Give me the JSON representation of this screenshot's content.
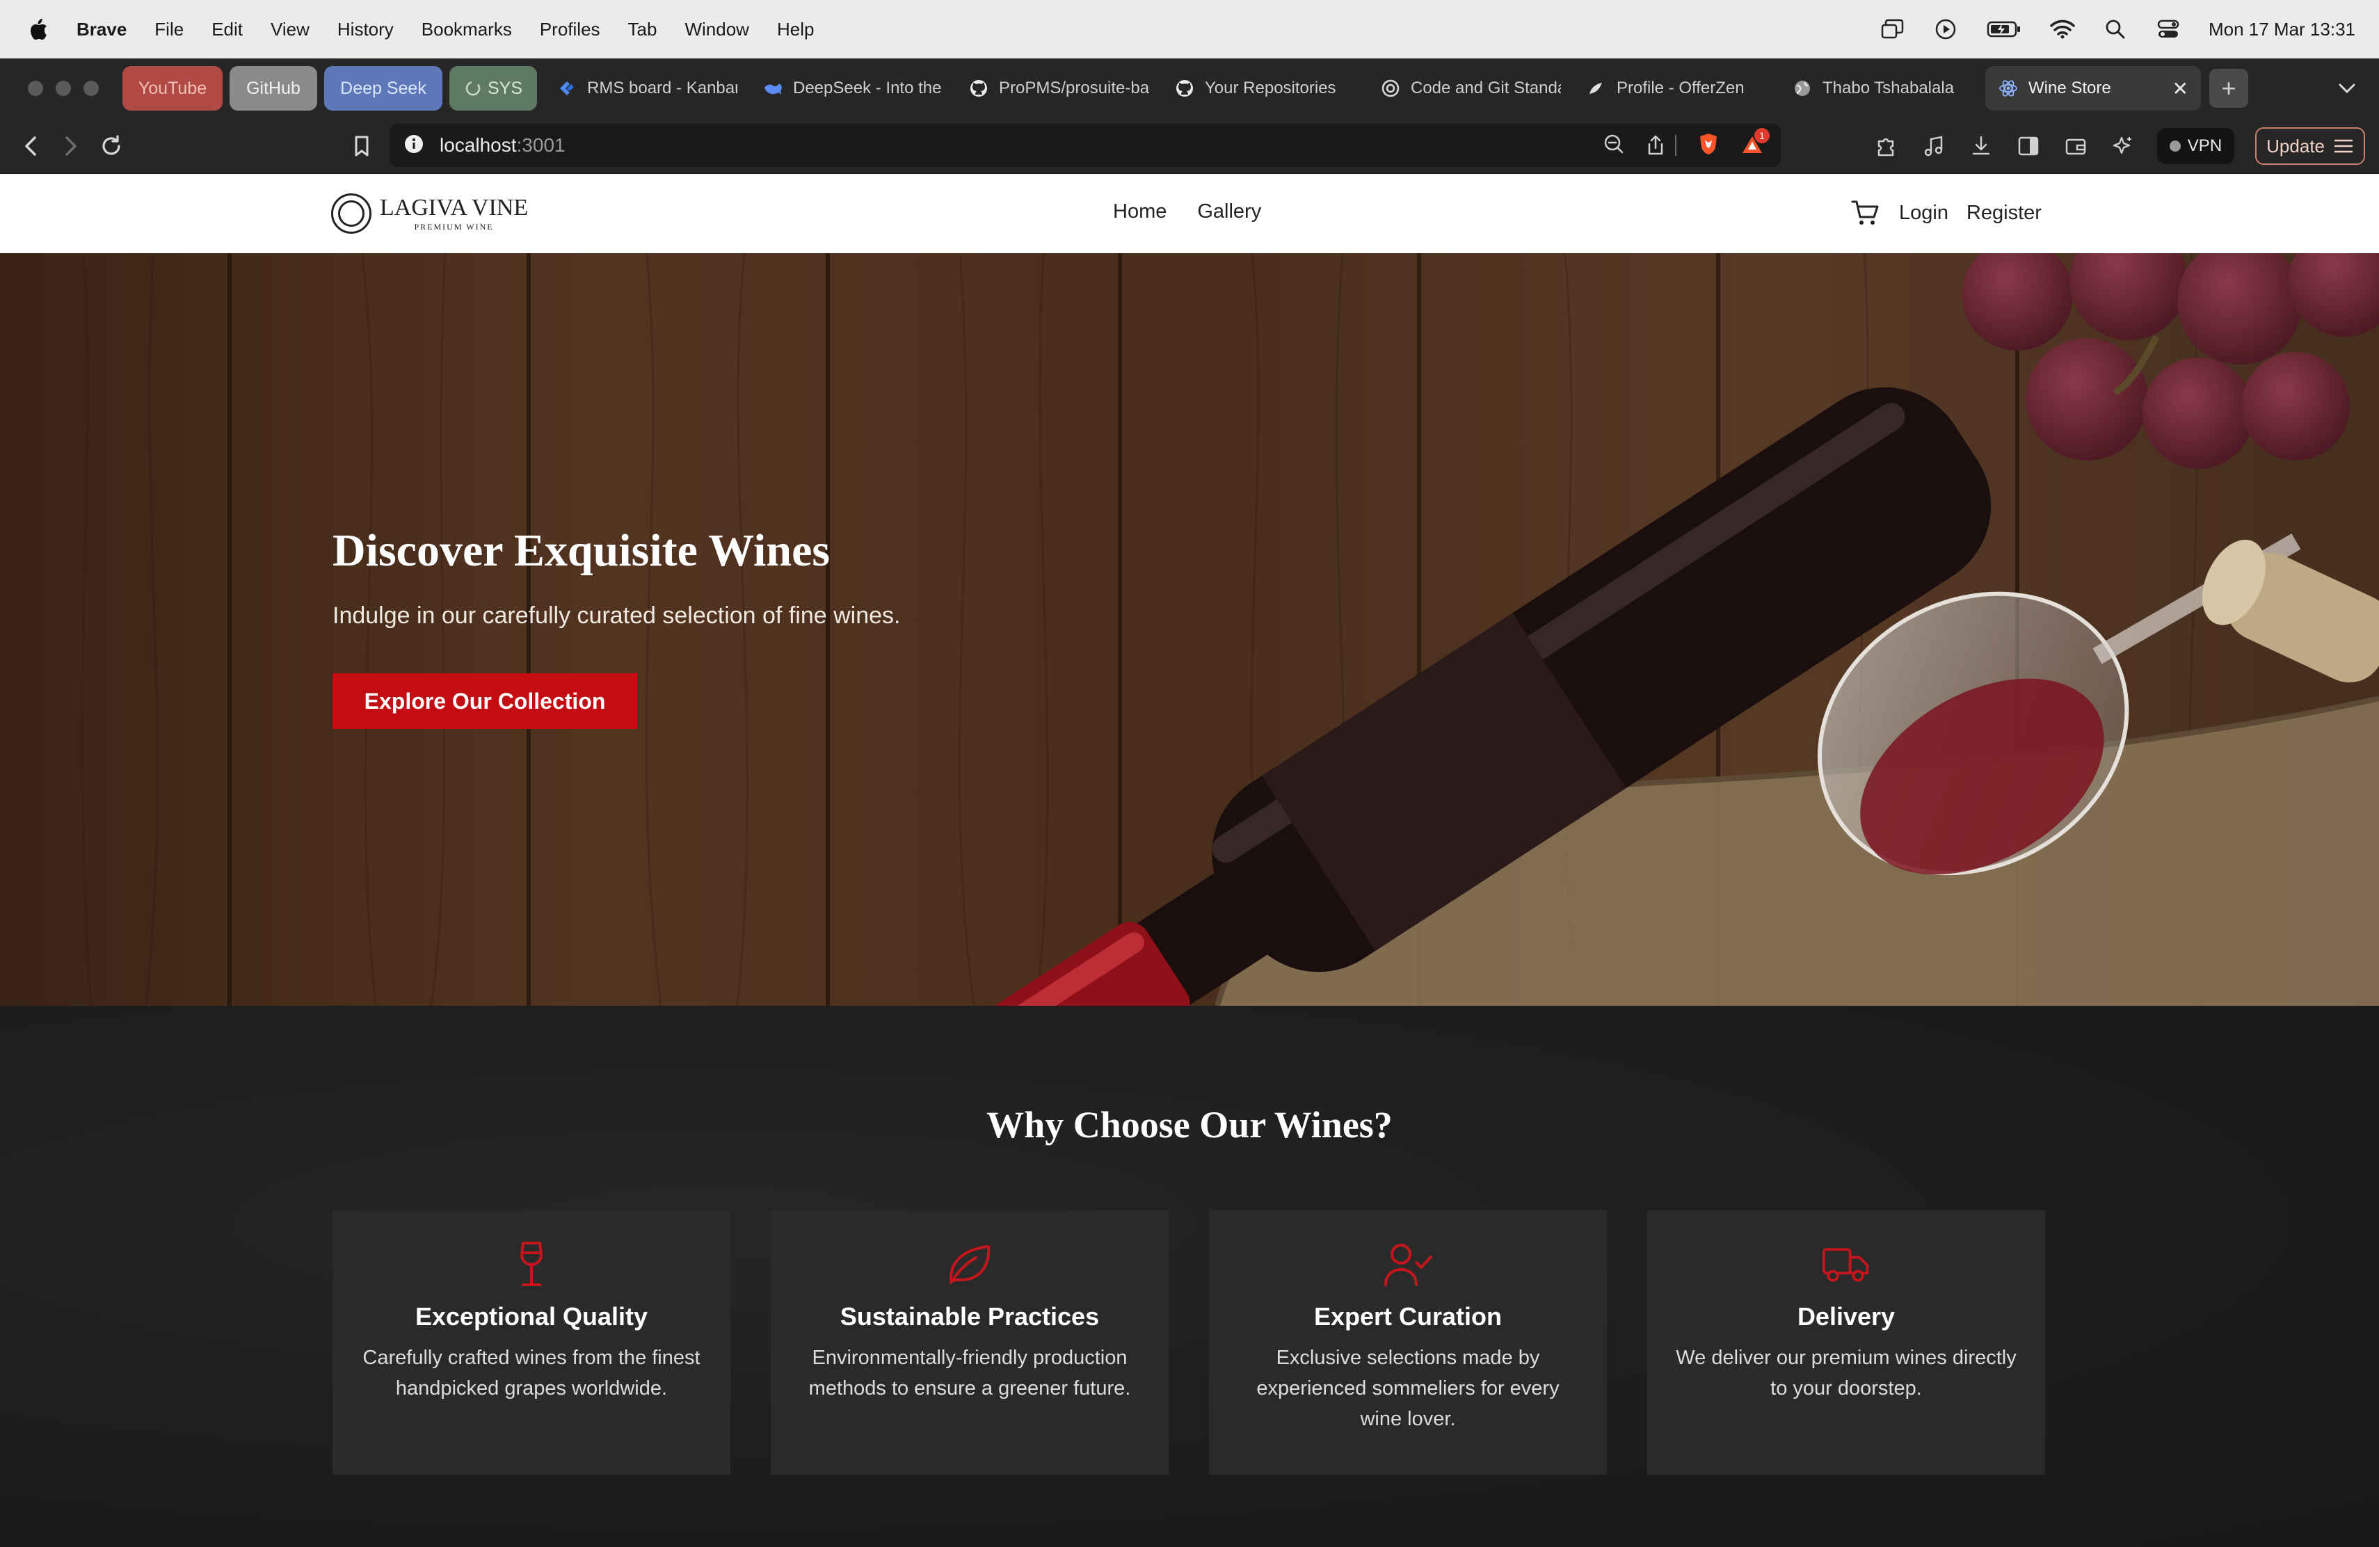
{
  "menubar": {
    "app": "Brave",
    "items": [
      "File",
      "Edit",
      "View",
      "History",
      "Bookmarks",
      "Profiles",
      "Tab",
      "Window",
      "Help"
    ],
    "clock": "Mon 17 Mar  13:31"
  },
  "pinned_tabs": [
    {
      "label": "YouTube",
      "color": "#b14a44",
      "text_color": "#f3c0b8"
    },
    {
      "label": "GitHub",
      "color": "#8a8a8a",
      "text_color": "#f1f1f1"
    },
    {
      "label": "Deep Seek",
      "color": "#5d77b8",
      "text_color": "#dbe6ff"
    },
    {
      "label": "SYS",
      "color": "#5e7a62",
      "text_color": "#d6e8d6"
    }
  ],
  "tabs": [
    {
      "label": "RMS board - Kanban",
      "icon": "jira-icon"
    },
    {
      "label": "DeepSeek - Into the Unknown",
      "icon": "deepseek-icon"
    },
    {
      "label": "ProPMS/prosuite-backend",
      "icon": "github-icon"
    },
    {
      "label": "Your Repositories",
      "icon": "github-icon"
    },
    {
      "label": "Code and Git Standards",
      "icon": "openai-icon"
    },
    {
      "label": "Profile - OfferZen",
      "icon": "offerzen-icon"
    },
    {
      "label": "Thabo Tshabalala",
      "icon": "globe-icon"
    },
    {
      "label": "Wine Store",
      "icon": "react-icon",
      "active": true
    }
  ],
  "toolbar": {
    "url_host": "localhost",
    "url_port": ":3001",
    "vpn_label": "VPN",
    "update_label": "Update",
    "brave_badge_count": "1"
  },
  "site": {
    "logo_name": "LAGIVA VINE",
    "logo_tagline": "PREMIUM WINE",
    "nav": [
      "Home",
      "Gallery"
    ],
    "auth": {
      "login": "Login",
      "register": "Register"
    }
  },
  "hero": {
    "title": "Discover Exquisite Wines",
    "subtitle": "Indulge in our carefully curated selection of fine wines.",
    "cta": "Explore Our Collection"
  },
  "features": {
    "title": "Why Choose Our Wines?",
    "accent_color": "#c4161c",
    "cards": [
      {
        "icon": "wine-glass-icon",
        "title": "Exceptional Quality",
        "desc": "Carefully crafted wines from the finest handpicked grapes worldwide."
      },
      {
        "icon": "leaf-icon",
        "title": "Sustainable Practices",
        "desc": "Environmentally-friendly production methods to ensure a greener future."
      },
      {
        "icon": "user-check-icon",
        "title": "Expert Curation",
        "desc": "Exclusive selections made by experienced sommeliers for every wine lover."
      },
      {
        "icon": "truck-icon",
        "title": "Delivery",
        "desc": "We deliver our premium wines directly to your doorstep."
      }
    ]
  }
}
